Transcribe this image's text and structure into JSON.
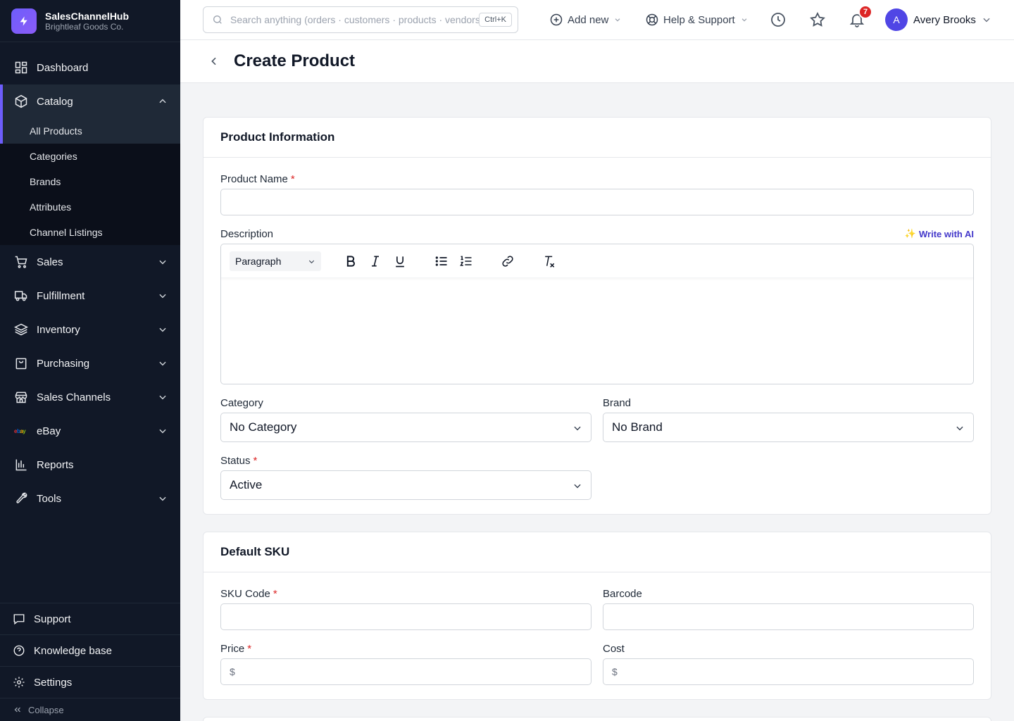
{
  "app": {
    "name": "SalesChannelHub",
    "org": "Brightleaf Goods Co."
  },
  "sidebar": {
    "items": [
      {
        "label": "Dashboard"
      },
      {
        "label": "Catalog"
      },
      {
        "label": "Sales"
      },
      {
        "label": "Fulfillment"
      },
      {
        "label": "Inventory"
      },
      {
        "label": "Purchasing"
      },
      {
        "label": "Sales Channels"
      },
      {
        "label": "eBay"
      },
      {
        "label": "Reports"
      },
      {
        "label": "Tools"
      }
    ],
    "catalog_sub": [
      "All Products",
      "Categories",
      "Brands",
      "Attributes",
      "Channel Listings"
    ],
    "bottom": {
      "support": "Support",
      "knowledge": "Knowledge base",
      "settings": "Settings",
      "collapse": "Collapse"
    }
  },
  "topbar": {
    "search_placeholder": "Search anything (orders · customers · products · vendors)",
    "shortcut": "Ctrl+K",
    "add_new": "Add new",
    "help": "Help & Support",
    "notifications_count": "7",
    "user_initial": "A",
    "user_name": "Avery Brooks"
  },
  "page": {
    "title": "Create Product"
  },
  "product_info": {
    "title": "Product Information",
    "name_label": "Product Name",
    "name_value": "",
    "description_label": "Description",
    "ai_label": "Write with AI",
    "paragraph": "Paragraph",
    "category_label": "Category",
    "category_value": "No Category",
    "brand_label": "Brand",
    "brand_value": "No Brand",
    "status_label": "Status",
    "status_value": "Active"
  },
  "default_sku": {
    "title": "Default SKU",
    "sku_label": "SKU Code",
    "barcode_label": "Barcode",
    "price_label": "Price",
    "cost_label": "Cost",
    "currency": "$"
  },
  "required_mark": "*"
}
